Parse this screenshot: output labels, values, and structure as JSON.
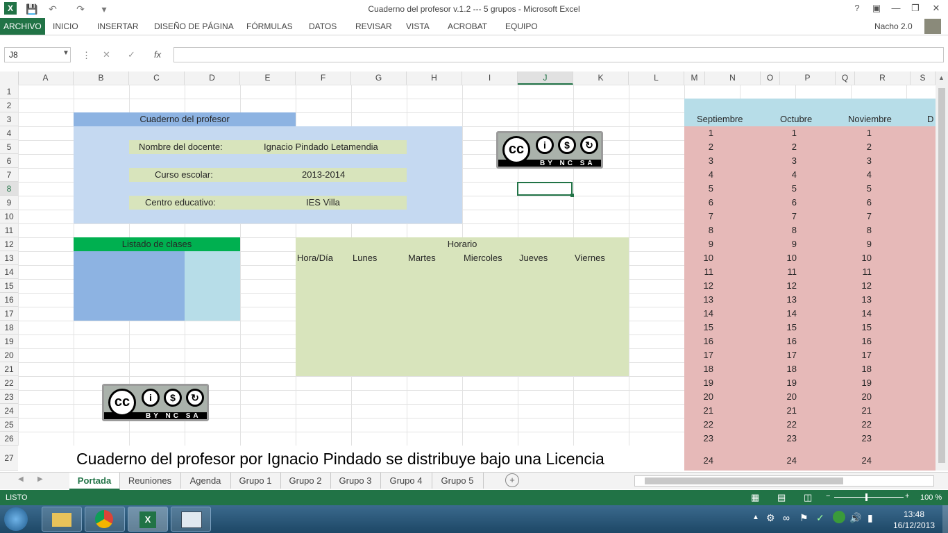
{
  "window": {
    "title": "Cuaderno del profesor v.1.2 --- 5 grupos - Microsoft Excel",
    "user": "Nacho 2.0"
  },
  "ribbon_tabs": [
    "ARCHIVO",
    "INICIO",
    "INSERTAR",
    "DISEÑO DE PÁGINA",
    "FÓRMULAS",
    "DATOS",
    "REVISAR",
    "VISTA",
    "ACROBAT",
    "EQUIPO"
  ],
  "formula_bar": {
    "name_box": "J8",
    "formula": ""
  },
  "columns": [
    "A",
    "B",
    "C",
    "D",
    "E",
    "F",
    "G",
    "H",
    "I",
    "J",
    "K",
    "L",
    "M",
    "N",
    "O",
    "P",
    "Q",
    "R",
    "S"
  ],
  "rows": [
    "1",
    "2",
    "3",
    "4",
    "5",
    "6",
    "7",
    "8",
    "9",
    "10",
    "11",
    "12",
    "13",
    "14",
    "15",
    "16",
    "17",
    "18",
    "19",
    "20",
    "21",
    "22",
    "23",
    "24",
    "25",
    "26",
    "27"
  ],
  "selected": {
    "column": "J",
    "row": "8"
  },
  "cover": {
    "title": "Cuaderno del profesor",
    "teacher_label": "Nombre del docente:",
    "teacher_value": "Ignacio Pindado Letamendia",
    "year_label": "Curso escolar:",
    "year_value": "2013-2014",
    "school_label": "Centro educativo:",
    "school_value": "IES Villa",
    "classes_title": "Listado de clases",
    "schedule_title": "Horario",
    "schedule_headers": [
      "Hora/Día",
      "Lunes",
      "Martes",
      "Miercoles",
      "Jueves",
      "Viernes"
    ],
    "license_text": "Cuaderno del profesor por Ignacio Pindado se distribuye bajo una Licencia",
    "cc_label": "BY NC SA",
    "cc_letters": "cc"
  },
  "calendar": {
    "months": [
      "Septiembre",
      "Octubre",
      "Noviembre",
      "D"
    ],
    "days": [
      "1",
      "2",
      "3",
      "4",
      "5",
      "6",
      "7",
      "8",
      "9",
      "10",
      "11",
      "12",
      "13",
      "14",
      "15",
      "16",
      "17",
      "18",
      "19",
      "20",
      "21",
      "22",
      "23",
      "24"
    ]
  },
  "sheet_tabs": [
    "Portada",
    "Reuniones",
    "Agenda",
    "Grupo 1",
    "Grupo 2",
    "Grupo 3",
    "Grupo 4",
    "Grupo 5"
  ],
  "status": {
    "mode": "LISTO",
    "zoom": "100 %"
  },
  "taskbar": {
    "time": "13:48",
    "date": "16/12/2013"
  },
  "colors": {
    "excel_green": "#217346",
    "header_blue": "#8db3e2",
    "panel_blue": "#c5d9f1",
    "field_green": "#d8e4bc",
    "class_green": "#00b050",
    "calendar_header": "#b7dde8",
    "calendar_body": "#e6b9b8"
  }
}
